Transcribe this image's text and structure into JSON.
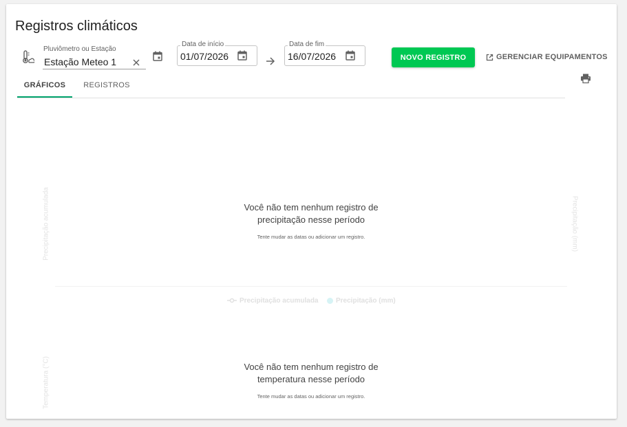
{
  "header": {
    "title": "Registros climáticos"
  },
  "filters": {
    "station_label": "Pluviômetro ou Estação",
    "station_value": "Estação Meteo 1",
    "start_date_label": "Data de início",
    "start_date_value": "01/07/2026",
    "end_date_label": "Data de fim",
    "end_date_value": "16/07/2026"
  },
  "actions": {
    "new_record_label": "NOVO REGISTRO",
    "manage_equipment_label": "GERENCIAR EQUIPAMENTOS"
  },
  "tabs": [
    {
      "label": "GRÁFICOS",
      "active": true
    },
    {
      "label": "REGISTROS",
      "active": false
    }
  ],
  "precipitation_chart": {
    "y_left_label": "Precipitação acumulada",
    "y_right_label": "Precipitação (mm)",
    "empty_title_line1": "Você não tem nenhum registro de",
    "empty_title_line2": "precipitação nesse período",
    "empty_subtitle": "Tente mudar as datas ou adicionar um registro.",
    "legend": [
      {
        "name": "Precipitação acumulada",
        "color": "#e0e0e0"
      },
      {
        "name": "Precipitação (mm)",
        "color": "#d6f3f5"
      }
    ]
  },
  "temperature_chart": {
    "y_left_label": "Temperatura (°C)",
    "empty_title_line1": "Você não tem nenhum registro de",
    "empty_title_line2": "temperatura nesse período",
    "empty_subtitle": "Tente mudar as datas ou adicionar um registro."
  },
  "colors": {
    "primary": "#00c853",
    "tab_indicator": "#00a36c"
  },
  "icons": [
    "thermometer-cloud-icon",
    "clear-icon",
    "calendar-icon",
    "arrow-right-icon",
    "external-link-icon",
    "print-icon"
  ]
}
